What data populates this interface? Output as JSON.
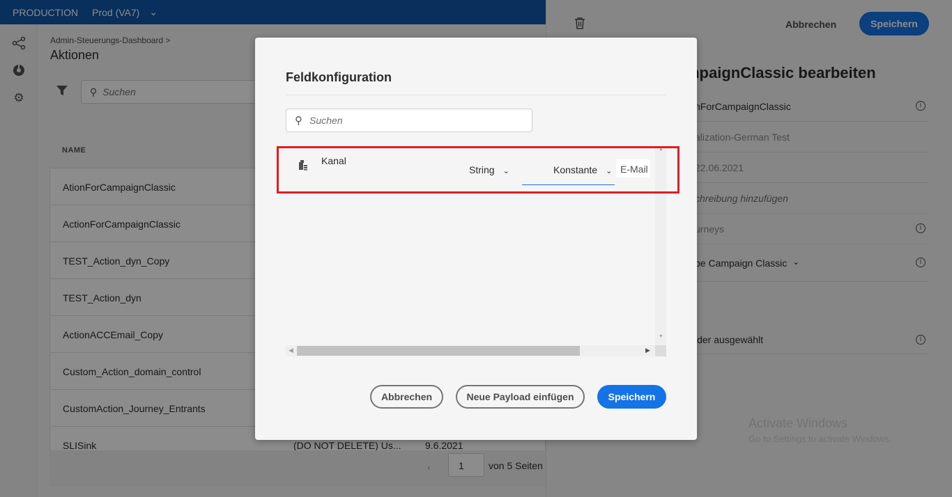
{
  "topbar": {
    "environment": "PRODUCTION",
    "org": "Prod (VA7)"
  },
  "rail": {
    "icons": [
      "journey-icon",
      "dashboard-icon",
      "settings-icon"
    ]
  },
  "main": {
    "breadcrumb": "Admin-Steuerungs-Dashboard >",
    "title": "Aktionen",
    "search_placeholder": "Suchen",
    "column_name": "NAME",
    "rows": [
      {
        "name": "AtionForCampaignClassic",
        "desc": "",
        "date": ""
      },
      {
        "name": "ActionForCampaignClassic",
        "desc": "",
        "date": ""
      },
      {
        "name": "TEST_Action_dyn_Copy",
        "desc": "",
        "date": ""
      },
      {
        "name": "TEST_Action_dyn",
        "desc": "",
        "date": ""
      },
      {
        "name": "ActionACCEmail_Copy",
        "desc": "",
        "date": ""
      },
      {
        "name": "Custom_Action_domain_control",
        "desc": "",
        "date": ""
      },
      {
        "name": "CustomAction_Journey_Entrants",
        "desc": "",
        "date": ""
      },
      {
        "name": "SLISink",
        "desc": "(DO NOT DELETE) Us...",
        "date": "9.6.2021"
      }
    ],
    "pager": {
      "page": "1",
      "of_label": "von 5 Seiten"
    }
  },
  "right_panel": {
    "cancel_label": "Abbrechen",
    "save_label": "Speichern",
    "title": "mpaignClassic bearbeiten",
    "rows": [
      {
        "value": "nForCampaignClassic"
      },
      {
        "value": "alization-German Test"
      },
      {
        "value": "22.06.2021"
      },
      {
        "value": "chreibung hinzufügen"
      },
      {
        "value": "urneys"
      },
      {
        "value": "be Campaign Classic"
      },
      {
        "value": "lder ausgewählt"
      }
    ],
    "watermark_title": "Activate Windows",
    "watermark_sub": "Go to Settings to activate Windows."
  },
  "modal": {
    "title": "Feldkonfiguration",
    "search_placeholder": "Suchen",
    "field": {
      "name": "Kanal",
      "type": "String",
      "mode": "Konstante",
      "value": "E-Mail"
    },
    "buttons": {
      "cancel": "Abbrechen",
      "insert_payload": "Neue Payload einfügen",
      "save": "Speichern"
    }
  }
}
